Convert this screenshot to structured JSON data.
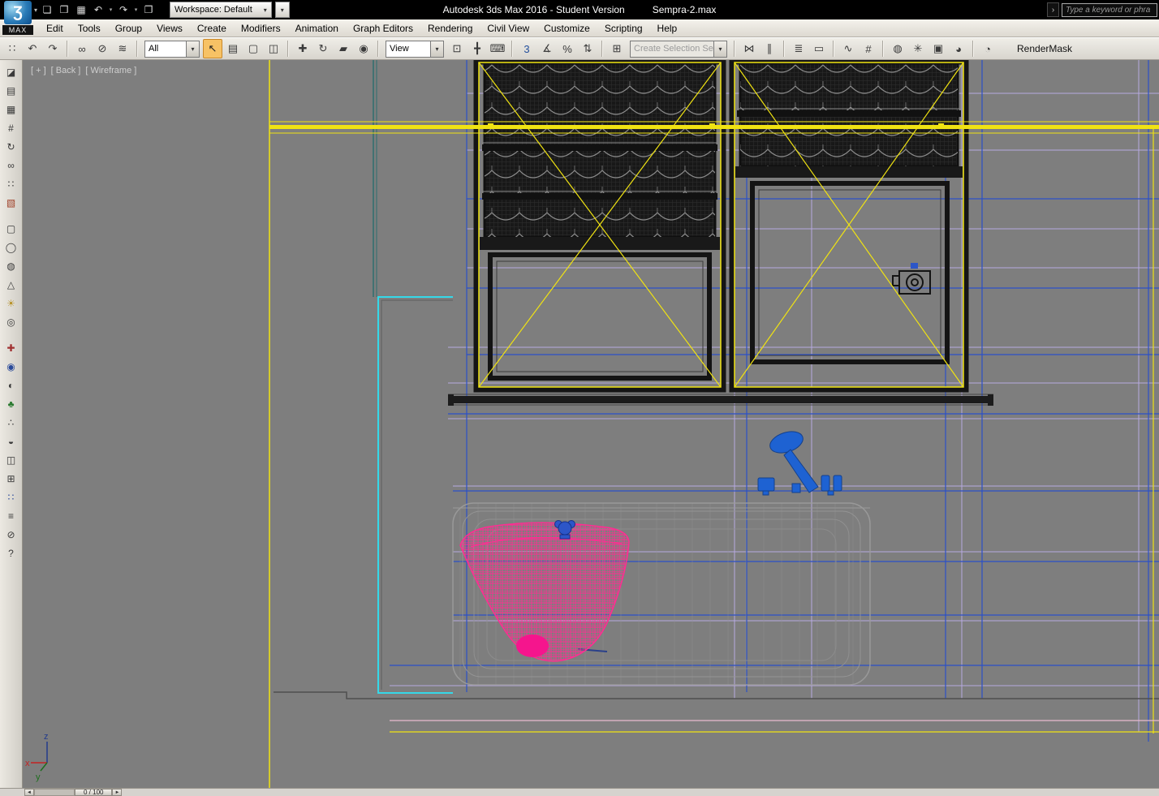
{
  "shared": {
    "dropdown_arrow": "▾"
  },
  "titlebar": {
    "logo_glyph": "Ʒ",
    "logo_label": "MAX",
    "title_main": "Autodesk 3ds Max 2016 - Student Version",
    "title_file": "Sempra-2.max",
    "workspace_label": "Workspace: Default",
    "search_expand": "›",
    "search_placeholder": "Type a keyword or phra",
    "quick_access": [
      {
        "name": "new-file-icon",
        "glyph": "❏"
      },
      {
        "name": "open-file-icon",
        "glyph": "❒"
      },
      {
        "name": "save-file-icon",
        "glyph": "▦"
      },
      {
        "name": "undo-icon",
        "glyph": "↶"
      },
      {
        "name": "undo-flyout-icon",
        "glyph": "▾",
        "small": true
      },
      {
        "name": "redo-icon",
        "glyph": "↷"
      },
      {
        "name": "redo-flyout-icon",
        "glyph": "▾",
        "small": true
      },
      {
        "name": "project-folder-icon",
        "glyph": "❐"
      }
    ]
  },
  "menubar": {
    "items": [
      "Edit",
      "Tools",
      "Group",
      "Views",
      "Create",
      "Modifiers",
      "Animation",
      "Graph Editors",
      "Rendering",
      "Civil View",
      "Customize",
      "Scripting",
      "Help"
    ]
  },
  "toolbar": {
    "selection_filter_value": "All",
    "coord_system_value": "View",
    "named_sets_placeholder": "Create Selection Se",
    "rendermask_label": "RenderMask",
    "group1": [
      {
        "name": "toolbar-grip-icon",
        "glyph": "∷"
      },
      {
        "name": "undo-icon",
        "glyph": "↶"
      },
      {
        "name": "redo-icon",
        "glyph": "↷"
      },
      {
        "sep": true
      },
      {
        "name": "select-and-link-icon",
        "glyph": "∞"
      },
      {
        "name": "unlink-selection-icon",
        "glyph": "⊘"
      },
      {
        "name": "bind-to-space-warp-icon",
        "glyph": "≋"
      },
      {
        "sep": true
      }
    ],
    "group2": [
      {
        "name": "select-object-icon",
        "glyph": "↖",
        "active": true
      },
      {
        "name": "select-by-name-icon",
        "glyph": "▤"
      },
      {
        "name": "rectangular-selection-region-icon",
        "glyph": "▢"
      },
      {
        "name": "window-crossing-icon",
        "glyph": "◫"
      },
      {
        "sep": true
      },
      {
        "name": "select-and-move-icon",
        "glyph": "✚"
      },
      {
        "name": "select-and-rotate-icon",
        "glyph": "↻"
      },
      {
        "name": "select-and-uniform-scale-icon",
        "glyph": "▰"
      },
      {
        "name": "select-and-place-icon",
        "glyph": "◉"
      },
      {
        "sep": true
      }
    ],
    "group3": [
      {
        "name": "use-pivot-point-center-icon",
        "glyph": "⊡"
      },
      {
        "name": "select-and-manipulate-icon",
        "glyph": "╋"
      },
      {
        "name": "keyboard-shortcut-override-icon",
        "glyph": "⌨"
      },
      {
        "sep": true
      },
      {
        "name": "snaps-toggle-3d-icon",
        "glyph": "3",
        "color": "#24509c"
      },
      {
        "name": "angle-snap-icon",
        "glyph": "∡"
      },
      {
        "name": "percent-snap-icon",
        "glyph": "%"
      },
      {
        "name": "spinner-snap-icon",
        "glyph": "⇅"
      },
      {
        "sep": true
      },
      {
        "name": "edit-named-selection-sets-icon",
        "glyph": "⊞"
      }
    ],
    "group4": [
      {
        "sep": true
      },
      {
        "name": "mirror-icon",
        "glyph": "⋈"
      },
      {
        "name": "align-icon",
        "glyph": "∥"
      },
      {
        "sep": true
      },
      {
        "name": "manage-layers-icon",
        "glyph": "≣"
      },
      {
        "name": "graphite-ribbon-icon",
        "glyph": "▭"
      },
      {
        "sep": true
      },
      {
        "name": "curve-editor-icon",
        "glyph": "∿"
      },
      {
        "name": "schematic-view-icon",
        "glyph": "#"
      },
      {
        "sep": true
      },
      {
        "name": "material-editor-icon",
        "glyph": "◍"
      },
      {
        "name": "render-setup-icon",
        "glyph": "✳"
      },
      {
        "name": "rendered-frame-window-icon",
        "glyph": "▣"
      },
      {
        "name": "render-production-icon",
        "glyph": "◕"
      },
      {
        "sep": true
      },
      {
        "name": "render-iterative-icon",
        "glyph": "◔"
      }
    ]
  },
  "left_toolbar": {
    "icons": [
      {
        "name": "viewport-layout-icon",
        "glyph": "◪"
      },
      {
        "name": "scene-explorer-icon",
        "glyph": "▤"
      },
      {
        "name": "grid-toggle-icon",
        "glyph": "▦"
      },
      {
        "name": "lattice-icon",
        "glyph": "#"
      },
      {
        "name": "arc-rotate-icon",
        "glyph": "↻"
      },
      {
        "name": "link-icon",
        "glyph": "∞"
      },
      {
        "name": "array-icon",
        "glyph": "∷"
      },
      {
        "name": "render-preview-icon",
        "glyph": "▧",
        "color": "#a04028"
      },
      {
        "sep": true
      },
      {
        "name": "rectangle-tool-icon",
        "glyph": "▢"
      },
      {
        "name": "ellipse-tool-icon",
        "glyph": "◯"
      },
      {
        "name": "sphere-tool-icon",
        "glyph": "◍"
      },
      {
        "name": "cone-tool-icon",
        "glyph": "△"
      },
      {
        "name": "light-tool-icon",
        "glyph": "☀",
        "color": "#b8932a"
      },
      {
        "name": "target-tool-icon",
        "glyph": "◎"
      },
      {
        "sep": true
      },
      {
        "name": "paint-deform-icon",
        "glyph": "✚",
        "color": "#a03030"
      },
      {
        "name": "pivot-icon",
        "glyph": "◉",
        "color": "#2a4a9a"
      },
      {
        "name": "material-sphere-icon",
        "glyph": "◐"
      },
      {
        "name": "foliage-icon",
        "glyph": "♣",
        "color": "#2a7a30"
      },
      {
        "name": "spray-icon",
        "glyph": "∴"
      },
      {
        "name": "shell-icon",
        "glyph": "◒"
      },
      {
        "name": "window-tool-icon",
        "glyph": "◫"
      },
      {
        "name": "table-icon",
        "glyph": "⊞"
      },
      {
        "name": "dots-icon",
        "glyph": "∷",
        "color": "#2a4a9a"
      },
      {
        "name": "list-icon",
        "glyph": "≡"
      },
      {
        "name": "no-render-icon",
        "glyph": "⊘"
      },
      {
        "name": "help-icon",
        "glyph": "?"
      }
    ]
  },
  "viewport": {
    "labels": [
      "[ + ]",
      "[ Back ]",
      "[ Wireframe ]"
    ],
    "axis": {
      "x": "x",
      "y": "y",
      "z": "z"
    }
  },
  "statusbar": {
    "prev_arrow": "◄",
    "next_arrow": "►",
    "frame_indicator": "0 / 100"
  },
  "colors": {
    "selection_yellow": "#f0e312",
    "grid_blue": "#2b50c8",
    "grid_lavender": "#b7a9e0",
    "sink_pink": "#ff2d92",
    "faucet_blue": "#1e62d2",
    "outline_cyan": "#35d8e8",
    "viewport_gray": "#7e7e7e"
  }
}
